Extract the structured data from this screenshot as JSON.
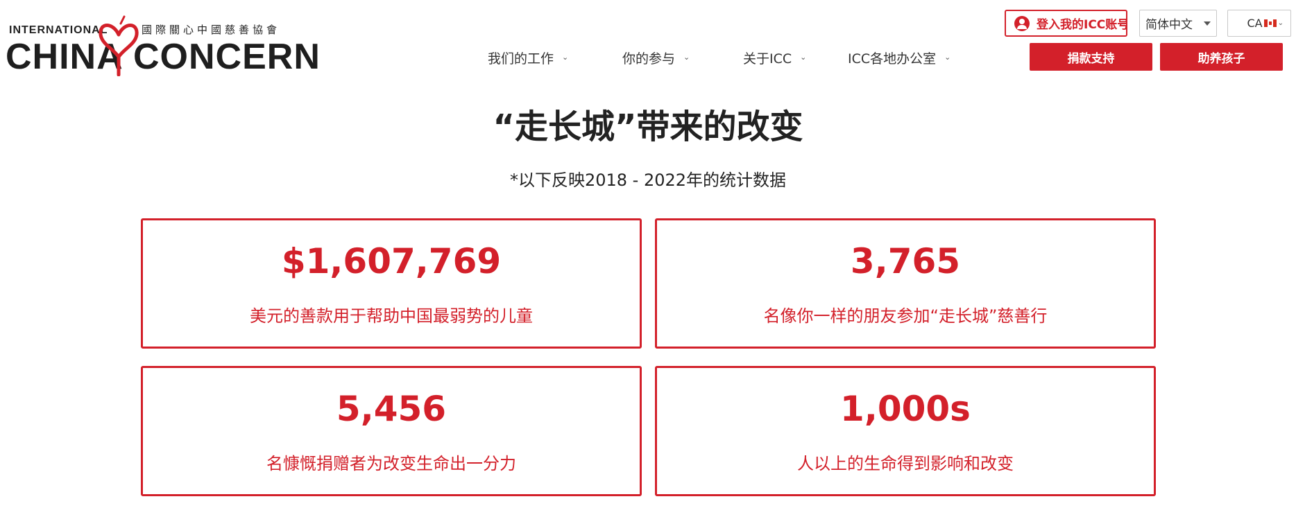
{
  "header": {
    "logo": {
      "top_line": "INTERNATIONAL",
      "chinese_name": "國際關心中國慈善協會",
      "word_left": "CHINA",
      "word_right": "CONCERN"
    },
    "nav": [
      {
        "label": "我们的工作"
      },
      {
        "label": "你的参与"
      },
      {
        "label": "关于ICC"
      },
      {
        "label": "ICC各地办公室"
      }
    ],
    "login_label": "登入我的ICC账号",
    "language": "简体中文",
    "country": "CA",
    "donate_label": "捐款支持",
    "sponsor_label": "助养孩子",
    "accent_color": "#d3202a"
  },
  "main": {
    "title": "“走长城”带来的改变",
    "subtitle": "*以下反映2018 - 2022年的统计数据",
    "stats": [
      {
        "value": "$1,607,769",
        "description": "美元的善款用于帮助中国最弱势的儿童"
      },
      {
        "value": "3,765",
        "description": "名像你一样的朋友参加“走长城”慈善行"
      },
      {
        "value": "5,456",
        "description": "名慷慨捐赠者为改变生命出一分力"
      },
      {
        "value": "1,000s",
        "description": "人以上的生命得到影响和改变"
      }
    ]
  }
}
